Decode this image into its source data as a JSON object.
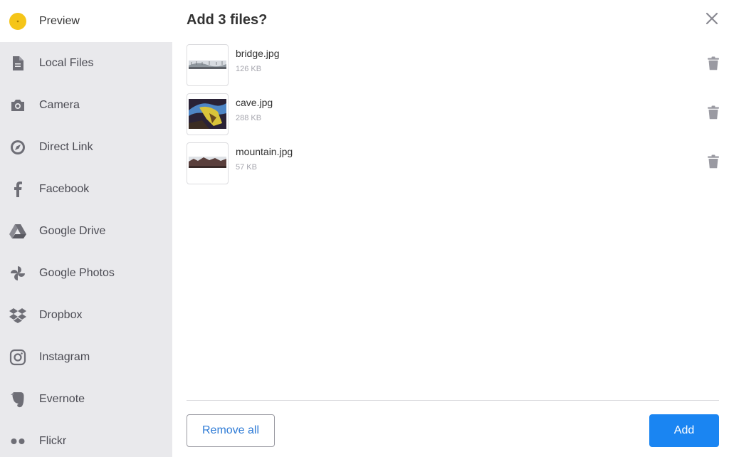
{
  "sidebar": {
    "items": [
      {
        "label": "Preview",
        "icon": "preview-dot-icon"
      },
      {
        "label": "Local Files",
        "icon": "file-icon"
      },
      {
        "label": "Camera",
        "icon": "camera-icon"
      },
      {
        "label": "Direct Link",
        "icon": "compass-icon"
      },
      {
        "label": "Facebook",
        "icon": "facebook-icon"
      },
      {
        "label": "Google Drive",
        "icon": "google-drive-icon"
      },
      {
        "label": "Google Photos",
        "icon": "google-photos-icon"
      },
      {
        "label": "Dropbox",
        "icon": "dropbox-icon"
      },
      {
        "label": "Instagram",
        "icon": "instagram-icon"
      },
      {
        "label": "Evernote",
        "icon": "evernote-icon"
      },
      {
        "label": "Flickr",
        "icon": "flickr-icon"
      }
    ]
  },
  "dialog": {
    "title": "Add 3 files?",
    "files": [
      {
        "name": "bridge.jpg",
        "size": "126 KB"
      },
      {
        "name": "cave.jpg",
        "size": "288 KB"
      },
      {
        "name": "mountain.jpg",
        "size": "57 KB"
      }
    ],
    "remove_all_label": "Remove all",
    "add_label": "Add"
  },
  "colors": {
    "accent": "#1a85f2",
    "sidebar_bg": "#e9e9ec",
    "preview_dot": "#f5c518",
    "link_text": "#2e7bd6"
  }
}
